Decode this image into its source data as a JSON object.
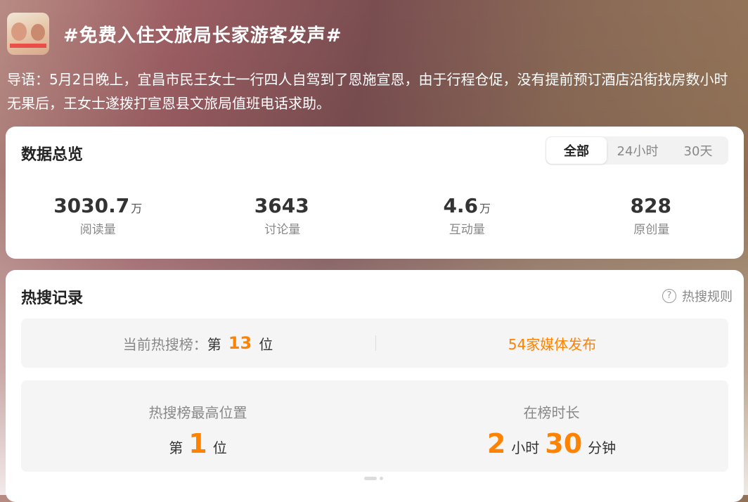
{
  "header": {
    "title": "#免费入住文旅局长家游客发声#",
    "intro": "导语：5月2日晚上，宜昌市民王女士一行四人自驾到了恩施宣恩，由于行程仓促，没有提前预订酒店沿街找房数小时无果后，王女士遂拨打宣恩县文旅局值班电话求助。"
  },
  "overview": {
    "title": "数据总览",
    "tabs": [
      "全部",
      "24小时",
      "30天"
    ],
    "active_tab": "全部",
    "stats": [
      {
        "value": "3030.7",
        "unit": "万",
        "label": "阅读量"
      },
      {
        "value": "3643",
        "unit": "",
        "label": "讨论量"
      },
      {
        "value": "4.6",
        "unit": "万",
        "label": "互动量"
      },
      {
        "value": "828",
        "unit": "",
        "label": "原创量"
      }
    ]
  },
  "hot": {
    "title": "热搜记录",
    "rules_label": "热搜规则",
    "current_label": "当前热搜榜：",
    "prefix": "第",
    "current_rank": "13",
    "suffix": "位",
    "media_link": "54家媒体发布",
    "peak_label": "热搜榜最高位置",
    "peak_rank": "1",
    "duration_label": "在榜时长",
    "duration_hours": "2",
    "hours_unit": "小时",
    "duration_minutes": "30",
    "minutes_unit": "分钟"
  },
  "colors": {
    "accent": "#ff8200",
    "card_bg": "#ffffff",
    "row_bg": "#f5f5f5"
  },
  "icons": {
    "help": "question-circle-icon"
  }
}
